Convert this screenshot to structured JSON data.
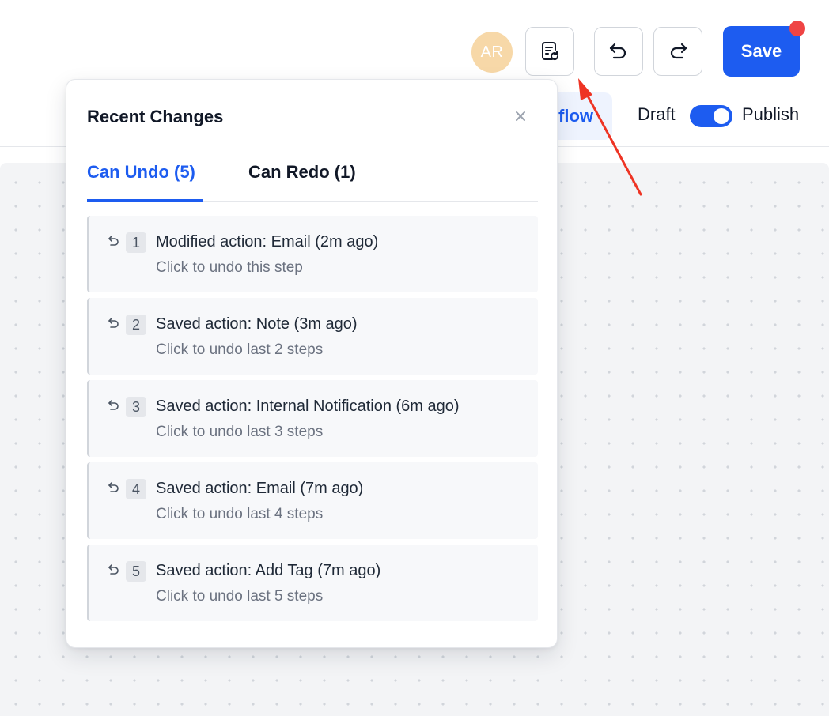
{
  "header": {
    "avatar_initials": "AR",
    "save_label": "Save",
    "history_icon": "history-document-icon",
    "undo_icon": "undo-icon",
    "redo_icon": "redo-icon",
    "notification_color": "#ef4444"
  },
  "subbar": {
    "active_tab_fragment": "flow",
    "draft_label": "Draft",
    "publish_label": "Publish",
    "publish_toggle_on": true
  },
  "popover": {
    "title": "Recent Changes",
    "close_icon": "close-icon",
    "tabs": [
      {
        "label": "Can Undo (5)",
        "active": true
      },
      {
        "label": "Can Redo (1)",
        "active": false
      }
    ],
    "undo_steps": [
      {
        "number": "1",
        "title": "Modified action: Email (2m ago)",
        "subtitle": "Click to undo this step"
      },
      {
        "number": "2",
        "title": "Saved action: Note (3m ago)",
        "subtitle": "Click to undo last 2 steps"
      },
      {
        "number": "3",
        "title": "Saved action: Internal Notification (6m ago)",
        "subtitle": "Click to undo last 3 steps"
      },
      {
        "number": "4",
        "title": "Saved action: Email (7m ago)",
        "subtitle": "Click to undo last 4 steps"
      },
      {
        "number": "5",
        "title": "Saved action: Add Tag (7m ago)",
        "subtitle": "Click to undo last 5 steps"
      }
    ]
  },
  "colors": {
    "primary": "#1d5cf0",
    "annotation_arrow": "#ee3424",
    "avatar_bg": "#f7d8a8"
  }
}
